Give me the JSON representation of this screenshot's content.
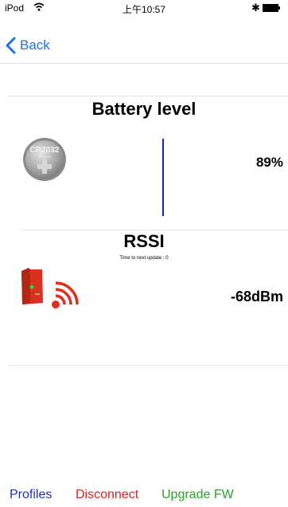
{
  "status_bar": {
    "carrier": "iPod",
    "time": "上午10:57",
    "wifi_icon": "wifi-icon",
    "bluetooth_icon": "bluetooth-icon",
    "battery_icon": "battery-icon"
  },
  "nav": {
    "back_label": "Back",
    "back_icon": "chevron-left-icon"
  },
  "battery": {
    "title": "Battery level",
    "coin_label": "CR2032",
    "coin_sublabel": "3 VOLTS",
    "level_percent": 89,
    "value": "89%"
  },
  "rssi": {
    "title": "RSSI",
    "next_update": "Time to next update : 0",
    "value": "-68dBm"
  },
  "tab_bar": {
    "profiles": "Profiles",
    "disconnect": "Disconnect",
    "upgrade": "Upgrade FW"
  },
  "colors": {
    "accent_blue": "#1a73e8",
    "profiles": "#1f2fbf",
    "disconnect": "#e02020",
    "upgrade": "#2ca02c",
    "battery_bar": "#1f1fa8",
    "device_red": "#d8321e"
  }
}
